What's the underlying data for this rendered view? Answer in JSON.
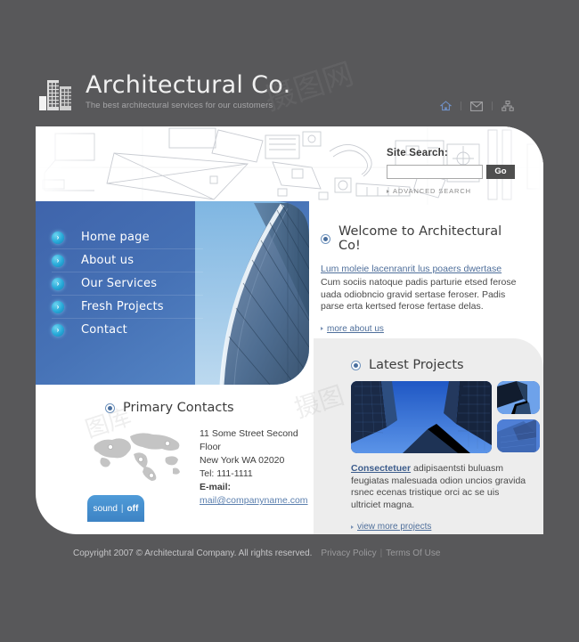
{
  "site": {
    "title": "Architectural Co.",
    "tagline": "The best architectural services for our customers"
  },
  "header": {
    "icons": [
      {
        "name": "home-icon",
        "glyph": "⌂"
      },
      {
        "name": "mail-icon",
        "glyph": "✉"
      },
      {
        "name": "sitemap-icon",
        "glyph": "⛁"
      }
    ]
  },
  "search": {
    "label": "Site Search:",
    "value": "",
    "placeholder": "",
    "button": "Go",
    "advanced": "ADVANCED SEARCH"
  },
  "nav": {
    "items": [
      {
        "label": "Home page"
      },
      {
        "label": "About us"
      },
      {
        "label": "Our Services"
      },
      {
        "label": "Fresh Projects"
      },
      {
        "label": "Contact"
      }
    ]
  },
  "welcome": {
    "title": "Welcome to Architectural Co!",
    "lead_link": "Lum moleie lacenranrit lus poaers dwertase",
    "body": "Cum sociis natoque padis parturie etsed ferose uada odiobncio gravid sertase feroser. Padis parse erta kertsed ferose fertase delas.",
    "more_link": "more about us"
  },
  "projects": {
    "title": "Latest Projects",
    "strong": "Consectetuer",
    "body": " adipisaentsti buluasm feugiatas malesuada odion uncios gravida rsnec ecenas tristique orci ac se uis ultriciet magna.",
    "more_link": "view more projects"
  },
  "contacts": {
    "title": "Primary Contacts",
    "address1": "11 Some Street Second Floor",
    "address2": "New York WA 02020",
    "tel": "Tel: 111-1111",
    "email_label": "E-mail:",
    "email": "mail@companyname.com"
  },
  "sound": {
    "label": "sound",
    "separator": "|",
    "state": "off"
  },
  "footer": {
    "copyright": "Copyright 2007 © Architectural Company. All rights reserved.",
    "privacy": "Privacy Policy",
    "separator": "|",
    "terms": "Terms Of Use"
  },
  "colors": {
    "page_background": "#58585a",
    "nav_blue_dark": "#3f64ab",
    "nav_blue_light": "#5c8fcd",
    "accent_cyan": "#27a9d8",
    "link_blue": "#4f6f9b",
    "panel_gray": "#ededed",
    "go_button": "#4f4f4f"
  }
}
